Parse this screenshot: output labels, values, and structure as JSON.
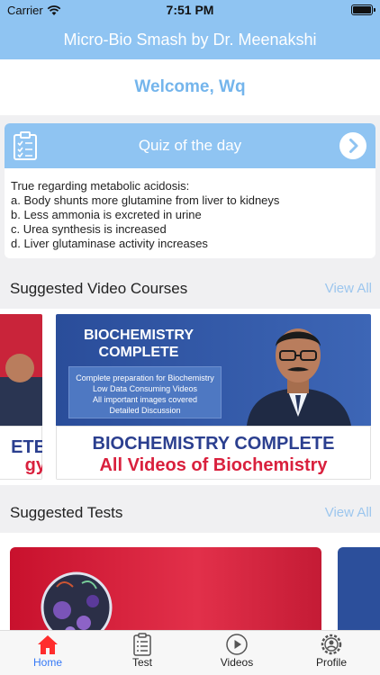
{
  "status": {
    "carrier": "Carrier",
    "time": "7:51 PM"
  },
  "app_title": "Micro-Bio Smash by Dr. Meenakshi",
  "welcome": "Welcome, Wq",
  "quiz": {
    "title": "Quiz of the day",
    "question": "True regarding metabolic acidosis:",
    "options": [
      "a. Body shunts more glutamine from liver to kidneys",
      "b. Less ammonia is excreted in urine",
      "c. Urea synthesis is increased",
      "d. Liver glutaminase activity increases"
    ]
  },
  "videos_section": {
    "title": "Suggested Video Courses",
    "view_all": "View All"
  },
  "video_main": {
    "banner_title_1": "BIOCHEMISTRY",
    "banner_title_2": "COMPLETE",
    "features": [
      "Complete preparation for Biochemistry",
      "Low Data Consuming Videos",
      "All important images covered",
      "Detailed Discussion"
    ],
    "caption_1": "BIOCHEMISTRY COMPLETE",
    "caption_2": "All Videos of Biochemistry"
  },
  "video_left": {
    "caption_1": "ETE",
    "caption_2": "gy"
  },
  "tests_section": {
    "title": "Suggested Tests",
    "view_all": "View All"
  },
  "tabs": [
    {
      "label": "Home",
      "icon": "home-icon"
    },
    {
      "label": "Test",
      "icon": "clipboard-icon"
    },
    {
      "label": "Videos",
      "icon": "play-icon"
    },
    {
      "label": "Profile",
      "icon": "profile-gear-icon"
    }
  ],
  "colors": {
    "accent": "#8fc4f2",
    "welcome_text": "#74b5ec",
    "active_tab": "#3478f6"
  }
}
